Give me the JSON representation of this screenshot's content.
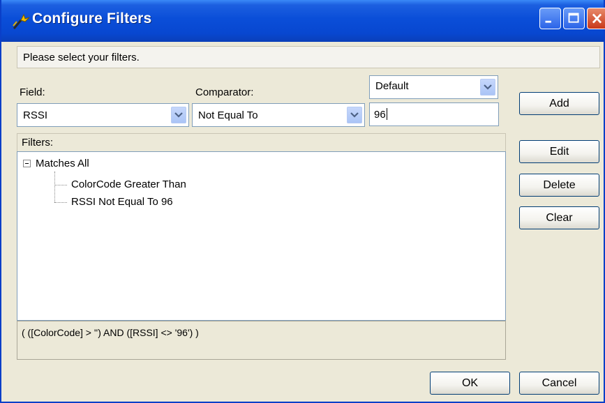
{
  "window": {
    "title": "Configure Filters"
  },
  "hint": "Please select your filters.",
  "field": {
    "label": "Field:",
    "value": "RSSI"
  },
  "comparator": {
    "label": "Comparator:",
    "value": "Not Equal To"
  },
  "mode": {
    "value": "Default"
  },
  "value_input": {
    "value": "96"
  },
  "buttons": {
    "add": "Add",
    "edit": "Edit",
    "delete": "Delete",
    "clear": "Clear",
    "ok": "OK",
    "cancel": "Cancel"
  },
  "filters": {
    "header": "Filters:",
    "root": "Matches All",
    "children": [
      "ColorCode Greater Than",
      "RSSI Not Equal To 96"
    ]
  },
  "expression": "( ([ColorCode] > '') AND ([RSSI] <> '96') )",
  "colors": {
    "titlebar": "#0a4ed8",
    "window_bg": "#ece9d8",
    "close_button": "#c8381a"
  }
}
